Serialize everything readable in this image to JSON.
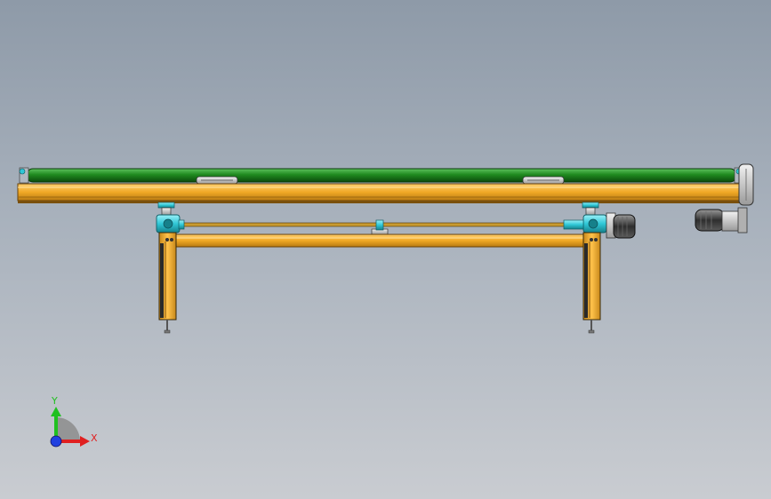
{
  "viewport": {
    "background_top": "#8e9aa8",
    "background_bottom": "#c9ccd1"
  },
  "colors": {
    "belt": "#1f8a1f",
    "frame": "#f0a825",
    "frame_dark": "#8a5a10",
    "fitting": "#2fc7d6",
    "motor": "#3a3a3a",
    "metal": "#c8c8c8"
  },
  "triad": {
    "x_label": "X",
    "y_label": "Y",
    "x_color": "#e02020",
    "y_color": "#20c020",
    "z_color": "#2040e0"
  },
  "icons": [
    "coordinate-triad-icon"
  ]
}
